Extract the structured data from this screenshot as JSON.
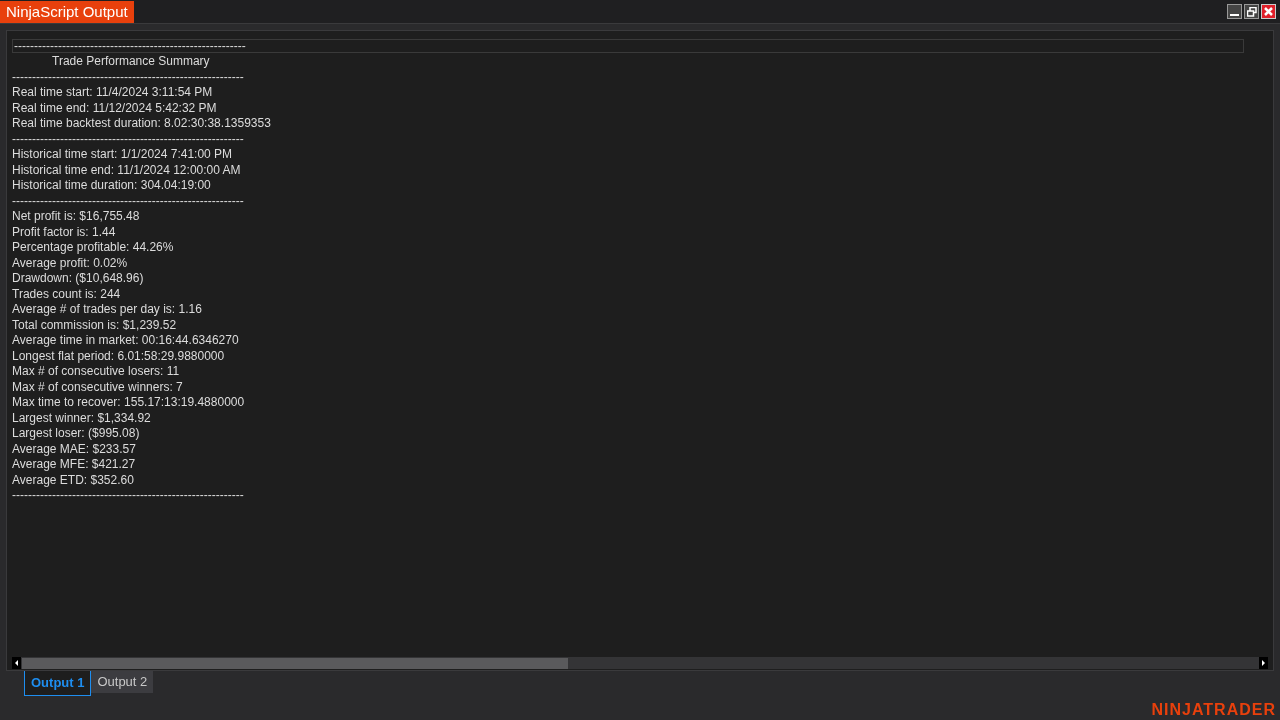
{
  "window": {
    "title": "NinjaScript Output"
  },
  "first_line": "----------------------------------------------------------",
  "lines": [
    {
      "kind": "heading",
      "text": "Trade Performance Summary"
    },
    {
      "kind": "text",
      "text": "----------------------------------------------------------"
    },
    {
      "kind": "text",
      "text": "Real time start: 11/4/2024 3:11:54 PM"
    },
    {
      "kind": "text",
      "text": "Real time end: 11/12/2024 5:42:32 PM"
    },
    {
      "kind": "text",
      "text": "Real time backtest duration: 8.02:30:38.1359353"
    },
    {
      "kind": "text",
      "text": "----------------------------------------------------------"
    },
    {
      "kind": "text",
      "text": "Historical time start: 1/1/2024 7:41:00 PM"
    },
    {
      "kind": "text",
      "text": "Historical time end: 11/1/2024 12:00:00 AM"
    },
    {
      "kind": "text",
      "text": "Historical time duration: 304.04:19:00"
    },
    {
      "kind": "text",
      "text": "----------------------------------------------------------"
    },
    {
      "kind": "text",
      "text": "Net profit is: $16,755.48"
    },
    {
      "kind": "text",
      "text": "Profit factor is: 1.44"
    },
    {
      "kind": "text",
      "text": "Percentage profitable: 44.26%"
    },
    {
      "kind": "text",
      "text": "Average profit: 0.02%"
    },
    {
      "kind": "text",
      "text": "Drawdown: ($10,648.96)"
    },
    {
      "kind": "text",
      "text": "Trades count is: 244"
    },
    {
      "kind": "text",
      "text": "Average # of trades per day is: 1.16"
    },
    {
      "kind": "text",
      "text": "Total commission is: $1,239.52"
    },
    {
      "kind": "text",
      "text": "Average time in market: 00:16:44.6346270"
    },
    {
      "kind": "text",
      "text": "Longest flat period: 6.01:58:29.9880000"
    },
    {
      "kind": "text",
      "text": "Max # of consecutive losers: 11"
    },
    {
      "kind": "text",
      "text": "Max # of consecutive winners: 7"
    },
    {
      "kind": "text",
      "text": "Max time to recover: 155.17:13:19.4880000"
    },
    {
      "kind": "text",
      "text": "Largest winner: $1,334.92"
    },
    {
      "kind": "text",
      "text": "Largest loser: ($995.08)"
    },
    {
      "kind": "text",
      "text": "Average MAE: $233.57"
    },
    {
      "kind": "text",
      "text": "Average MFE: $421.27"
    },
    {
      "kind": "text",
      "text": "Average ETD: $352.60"
    },
    {
      "kind": "text",
      "text": "----------------------------------------------------------"
    }
  ],
  "tabs": [
    {
      "label": "Output 1",
      "selected": true
    },
    {
      "label": "Output 2",
      "selected": false
    }
  ],
  "brand": "NINJATRADER"
}
